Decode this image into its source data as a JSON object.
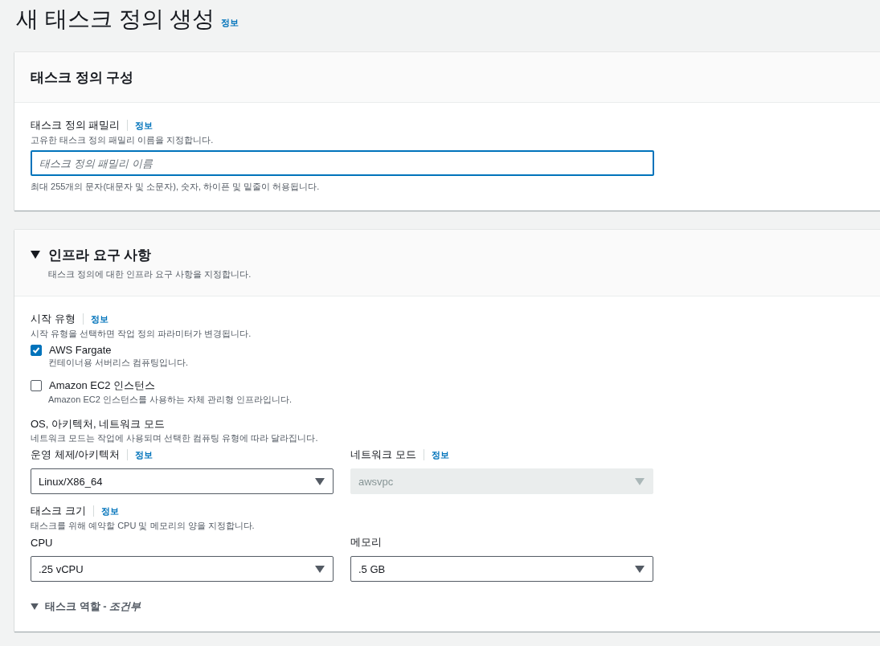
{
  "page": {
    "title": "새 태스크 정의 생성",
    "info": "정보"
  },
  "config_section": {
    "title": "태스크 정의 구성",
    "family": {
      "label": "태스크 정의 패밀리",
      "info": "정보",
      "description": "고유한 태스크 정의 패밀리 이름을 지정합니다.",
      "placeholder": "태스크 정의 패밀리 이름",
      "constraint": "최대 255개의 문자(대문자 및 소문자), 숫자, 하이픈 및 밑줄이 허용됩니다."
    }
  },
  "infra_section": {
    "title": "인프라 요구 사항",
    "expanded": true,
    "description": "태스크 정의에 대한 인프라 요구 사항을 지정합니다.",
    "launch_type": {
      "label": "시작 유형",
      "info": "정보",
      "description": "시작 유형을 선택하면 작업 정의 파라미터가 변경됩니다.",
      "options": [
        {
          "label": "AWS Fargate",
          "description": "컨테이너용 서버리스 컴퓨팅입니다.",
          "checked": true
        },
        {
          "label": "Amazon EC2 인스턴스",
          "description": "Amazon EC2 인스턴스를 사용하는 자체 관리형 인프라입니다.",
          "checked": false
        }
      ]
    },
    "os_group": {
      "title": "OS, 아키텍처, 네트워크 모드",
      "description": "네트워크 모드는 작업에 사용되며 선택한 컴퓨팅 유형에 따라 달라집니다.",
      "selects": [
        {
          "label": "운영 체제/아키텍처",
          "info": "정보",
          "value": "Linux/X86_64",
          "disabled": false
        },
        {
          "label": "네트워크 모드",
          "info": "정보",
          "value": "awsvpc",
          "disabled": true
        }
      ]
    },
    "task_size": {
      "label": "태스크 크기",
      "info": "정보",
      "description": "태스크를 위해 예약할 CPU 및 메모리의 양을 지정합니다.",
      "selects": [
        {
          "label": "CPU",
          "value": ".25 vCPU",
          "disabled": false
        },
        {
          "label": "메모리",
          "value": ".5 GB",
          "disabled": false
        }
      ]
    },
    "task_role": {
      "title": "태스크 역할 - *조건부*",
      "expanded": true
    }
  }
}
